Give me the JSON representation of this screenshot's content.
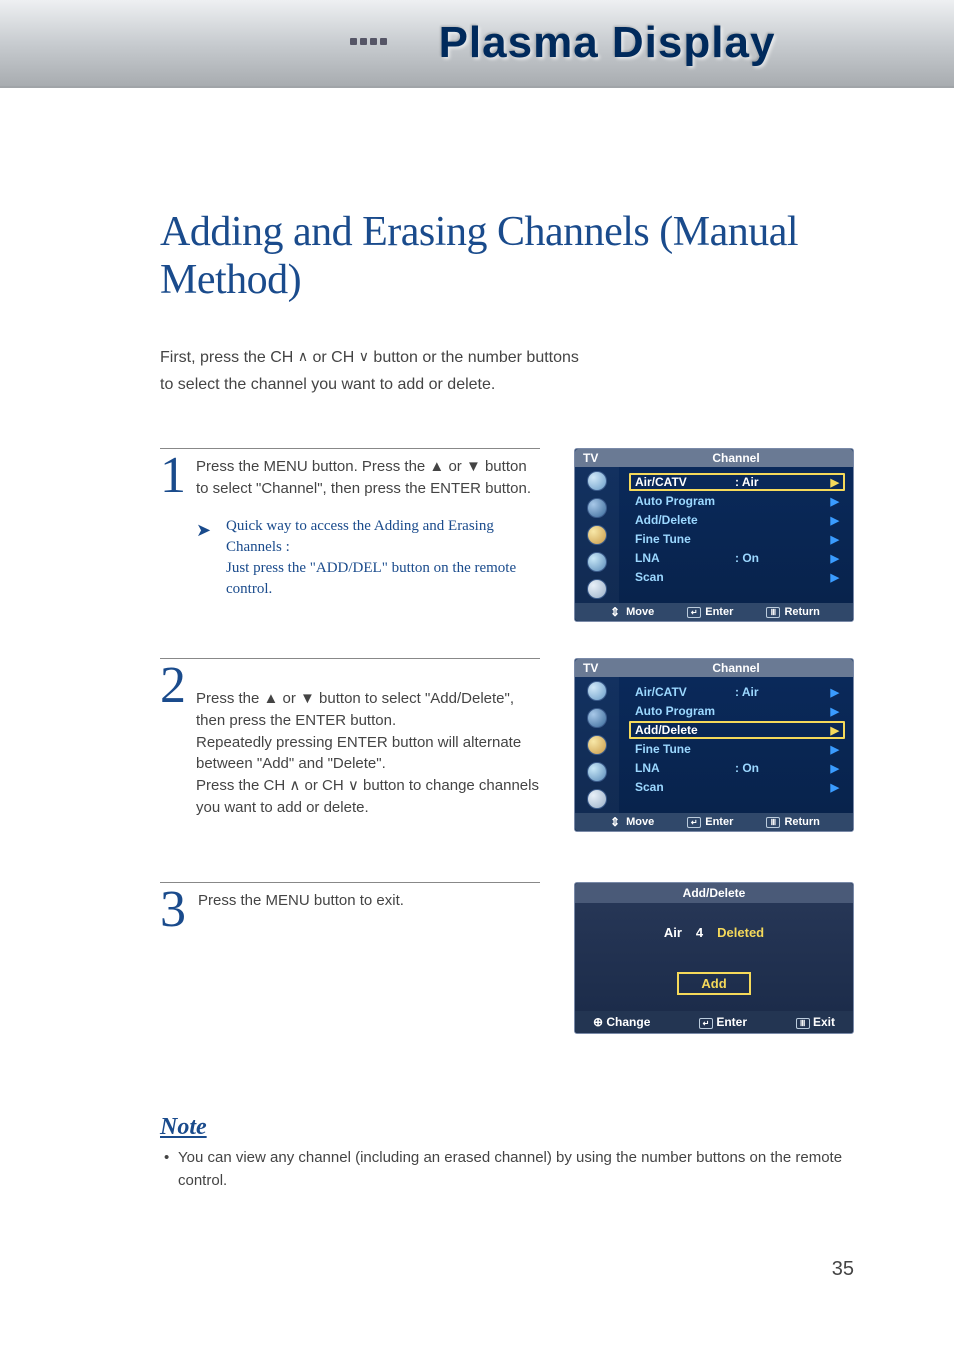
{
  "banner": {
    "title": "Plasma Display"
  },
  "page": {
    "title": "Adding and Erasing Channels (Manual Method)",
    "intro_l1": "First, press the CH ",
    "intro_up": "∧",
    "intro_mid": " or CH ",
    "intro_dn": "∨",
    "intro_l2": " button or the number buttons",
    "intro_l3": "to select the channel you want to add or delete.",
    "page_number": "35"
  },
  "steps": [
    {
      "num": "1",
      "text": "Press the MENU button. Press the ▲ or ▼ button to select \"Channel\", then press the ENTER button.",
      "quick_l1": "Quick way to access the Adding and Erasing Channels :",
      "quick_l2": "Just press the \"ADD/DEL\" button on the remote control."
    },
    {
      "num": "2",
      "text": "Press the ▲ or ▼ button to select \"Add/Delete\", then press the ENTER button.\nRepeatedly pressing ENTER button will alternate between \"Add\" and \"Delete\".\nPress the CH ∧  or CH ∨ button to change channels you want to add or delete."
    },
    {
      "num": "3",
      "text": "Press the MENU button to exit."
    }
  ],
  "osd1": {
    "tv": "TV",
    "title": "Channel",
    "rows": [
      {
        "label": "Air/CATV",
        "val": ":  Air",
        "sel": true
      },
      {
        "label": "Auto Program",
        "val": "",
        "sel": false
      },
      {
        "label": "Add/Delete",
        "val": "",
        "sel": false
      },
      {
        "label": "Fine Tune",
        "val": "",
        "sel": false
      },
      {
        "label": "LNA",
        "val": ":  On",
        "sel": false
      },
      {
        "label": "Scan",
        "val": "",
        "sel": false
      }
    ],
    "footer": {
      "move": "Move",
      "enter": "Enter",
      "return": "Return"
    }
  },
  "osd2": {
    "tv": "TV",
    "title": "Channel",
    "rows": [
      {
        "label": "Air/CATV",
        "val": ":  Air",
        "sel": false
      },
      {
        "label": "Auto Program",
        "val": "",
        "sel": false
      },
      {
        "label": "Add/Delete",
        "val": "",
        "sel": true
      },
      {
        "label": "Fine Tune",
        "val": "",
        "sel": false
      },
      {
        "label": "LNA",
        "val": ":  On",
        "sel": false
      },
      {
        "label": "Scan",
        "val": "",
        "sel": false
      }
    ],
    "footer": {
      "move": "Move",
      "enter": "Enter",
      "return": "Return"
    }
  },
  "osd3": {
    "title": "Add/Delete",
    "source": "Air",
    "ch": "4",
    "status": "Deleted",
    "button": "Add",
    "footer": {
      "change": "Change",
      "enter": "Enter",
      "exit": "Exit"
    }
  },
  "note": {
    "title": "Note",
    "text": "You can view any channel (including an erased channel) by using the number buttons on the remote control."
  }
}
